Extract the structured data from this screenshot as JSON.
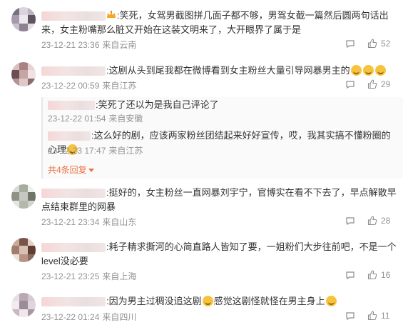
{
  "comments": [
    {
      "text": ":笑死，女驾男截图拼几面子都不够，男驾女截一篇然后圆两句话出来，女主粉嘴那么脏又开始在这装文明来了，大开眼界了属于是",
      "date": "23-12-21 23:36",
      "location": "来自云南",
      "likes": "52"
    },
    {
      "text": ":这剧从头到尾我都在微博看到女主粉丝大量引导网暴男主的",
      "date": "23-12-22 00:59",
      "location": "来自江苏",
      "likes": "29",
      "replies": [
        {
          "text": ":笑死了还以为是我自己评论了",
          "date": "23-12-22 01:54",
          "location": "来自安徽"
        },
        {
          "text": ":这么好的剧，应该两家粉丝团结起来好好宣传，哎，我其实搞不懂粉圈的心理",
          "date": "23-12-23 17:47",
          "location": "来自江苏"
        }
      ],
      "more_replies": "共4条回复"
    },
    {
      "text": ":挺好的，女主粉丝一直网暴刘宇宁，官博实在看不下去了，早点解散早点结束群里的网暴",
      "date": "23-12-21 23:34",
      "location": "来自山东",
      "likes": "28"
    },
    {
      "text": ":耗子精求撕河的心简直路人皆知了要，一姐粉们大步往前吧，不是一个level没必要",
      "date": "23-12-21 23:25",
      "location": "来自上海",
      "likes": "16"
    },
    {
      "text": ":因为男主过稠没追这剧",
      "text2": "感觉这剧怪就怪在男主身上",
      "date": "23-12-22 01:24",
      "location": "来自四川",
      "likes": "11"
    }
  ],
  "icons": {
    "share": "share-icon",
    "like": "thumbs-up-icon",
    "emoji": "laughing-emoji-icon",
    "crown": "crown-badge-icon"
  },
  "colors": {
    "accent": "#eb7340",
    "meta": "#939393",
    "text": "#333333"
  }
}
